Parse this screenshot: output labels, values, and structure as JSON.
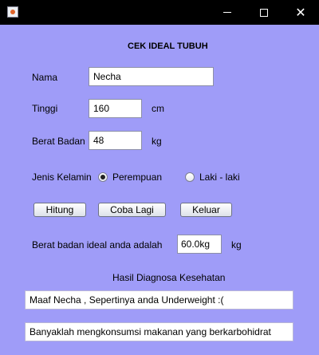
{
  "window": {
    "title": "",
    "icon": "java-app-icon",
    "controls": {
      "minimize": "minimize-icon",
      "maximize": "maximize-icon",
      "close": "✕"
    }
  },
  "form": {
    "heading": "CEK IDEAL TUBUH",
    "nama_label": "Nama",
    "nama_value": "Necha",
    "tinggi_label": "Tinggi",
    "tinggi_value": "160",
    "tinggi_unit": "cm",
    "berat_label": "Berat Badan",
    "berat_value": "48",
    "berat_unit": "kg",
    "gender_label": "Jenis Kelamin",
    "gender_options": [
      {
        "label": "Perempuan",
        "selected": true
      },
      {
        "label": "Laki - laki",
        "selected": false
      }
    ]
  },
  "buttons": {
    "hitung": "Hitung",
    "coba_lagi": "Coba Lagi",
    "keluar": "Keluar"
  },
  "result": {
    "ideal_label": "Berat badan ideal anda adalah",
    "ideal_value": "60.0kg",
    "ideal_unit": "kg",
    "diagnosis_title": "Hasil Diagnosa Kesehatan",
    "diagnosis_line1": "Maaf Necha , Sepertinya anda Underweight :(",
    "diagnosis_line2": "Banyaklah mengkonsumsi makanan yang berkarbohidrat"
  },
  "colors": {
    "background": "#9f9cf8",
    "titlebar": "#000000"
  }
}
